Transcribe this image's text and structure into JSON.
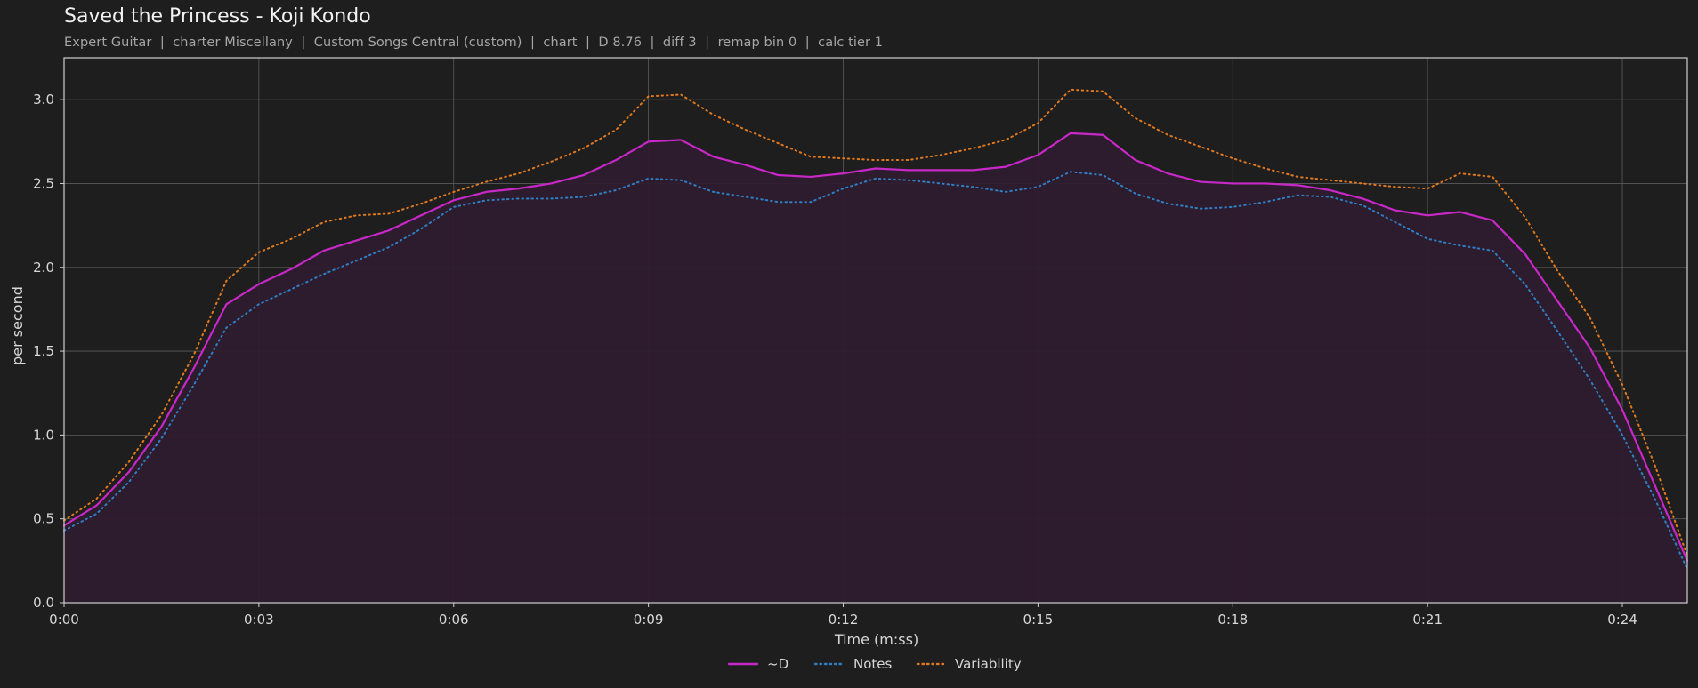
{
  "header": {
    "title": "Saved the Princess - Koji Kondo",
    "subtitle": "Expert Guitar  |  charter Miscellany  |  Custom Songs Central (custom)  |  chart  |  D 8.76  |  diff 3  |  remap bin 0  |  calc tier 1"
  },
  "colors": {
    "background": "#1e1e1e",
    "plot_background": "#1e1e1e",
    "grid": "#5a5a5a",
    "fill": "#2e1c2e",
    "d_line": "#c828c8",
    "notes_line": "#2f7fc4",
    "variability_line": "#e0781e"
  },
  "chart_data": {
    "type": "line",
    "title": "Saved the Princess - Koji Kondo",
    "xlabel": "Time (m:ss)",
    "ylabel": "per second",
    "xlim": [
      0,
      25
    ],
    "ylim": [
      0,
      3.25
    ],
    "x_ticks": [
      0,
      3,
      6,
      9,
      12,
      15,
      18,
      21,
      24
    ],
    "x_tick_labels": [
      "0:00",
      "0:03",
      "0:06",
      "0:09",
      "0:12",
      "0:15",
      "0:18",
      "0:21",
      "0:24"
    ],
    "y_ticks": [
      0,
      0.5,
      1.0,
      1.5,
      2.0,
      2.5,
      3.0
    ],
    "y_tick_labels": [
      "0.0",
      "0.5",
      "1.0",
      "1.5",
      "2.0",
      "2.5",
      "3.0"
    ],
    "grid": true,
    "legend_position": "bottom-center",
    "x": [
      0,
      0.5,
      1,
      1.5,
      2,
      2.5,
      3,
      3.5,
      4,
      4.5,
      5,
      5.5,
      6,
      6.5,
      7,
      7.5,
      8,
      8.5,
      9,
      9.5,
      10,
      10.5,
      11,
      11.5,
      12,
      12.5,
      13,
      13.5,
      14,
      14.5,
      15,
      15.5,
      16,
      16.5,
      17,
      17.5,
      18,
      18.5,
      19,
      19.5,
      20,
      20.5,
      21,
      21.5,
      22,
      22.5,
      23,
      23.5,
      24,
      24.5,
      25
    ],
    "series": [
      {
        "name": "~D",
        "style": "solid",
        "color": "#c828c8",
        "filled": true,
        "values": [
          0.46,
          0.58,
          0.78,
          1.05,
          1.4,
          1.78,
          1.9,
          1.99,
          2.1,
          2.16,
          2.22,
          2.31,
          2.4,
          2.45,
          2.47,
          2.5,
          2.55,
          2.64,
          2.75,
          2.76,
          2.66,
          2.61,
          2.55,
          2.54,
          2.56,
          2.59,
          2.58,
          2.58,
          2.58,
          2.6,
          2.67,
          2.8,
          2.79,
          2.64,
          2.56,
          2.51,
          2.5,
          2.5,
          2.49,
          2.46,
          2.41,
          2.34,
          2.31,
          2.33,
          2.28,
          2.08,
          1.8,
          1.52,
          1.15,
          0.7,
          0.25
        ]
      },
      {
        "name": "Notes",
        "style": "dotted",
        "color": "#2f7fc4",
        "filled": false,
        "values": [
          0.43,
          0.53,
          0.72,
          0.98,
          1.3,
          1.64,
          1.78,
          1.87,
          1.96,
          2.04,
          2.12,
          2.23,
          2.36,
          2.4,
          2.41,
          2.41,
          2.42,
          2.46,
          2.53,
          2.52,
          2.45,
          2.42,
          2.39,
          2.39,
          2.47,
          2.53,
          2.52,
          2.5,
          2.48,
          2.45,
          2.48,
          2.57,
          2.55,
          2.44,
          2.38,
          2.35,
          2.36,
          2.39,
          2.43,
          2.42,
          2.37,
          2.27,
          2.17,
          2.13,
          2.1,
          1.9,
          1.62,
          1.33,
          1.0,
          0.62,
          0.2
        ]
      },
      {
        "name": "Variability",
        "style": "dotted",
        "color": "#e0781e",
        "filled": false,
        "values": [
          0.49,
          0.62,
          0.84,
          1.12,
          1.48,
          1.92,
          2.09,
          2.17,
          2.27,
          2.31,
          2.32,
          2.38,
          2.45,
          2.51,
          2.56,
          2.63,
          2.71,
          2.82,
          3.02,
          3.03,
          2.91,
          2.82,
          2.74,
          2.66,
          2.65,
          2.64,
          2.64,
          2.67,
          2.71,
          2.76,
          2.86,
          3.06,
          3.05,
          2.89,
          2.79,
          2.72,
          2.65,
          2.59,
          2.54,
          2.52,
          2.5,
          2.48,
          2.47,
          2.56,
          2.54,
          2.3,
          1.98,
          1.7,
          1.3,
          0.82,
          0.28
        ]
      }
    ]
  }
}
